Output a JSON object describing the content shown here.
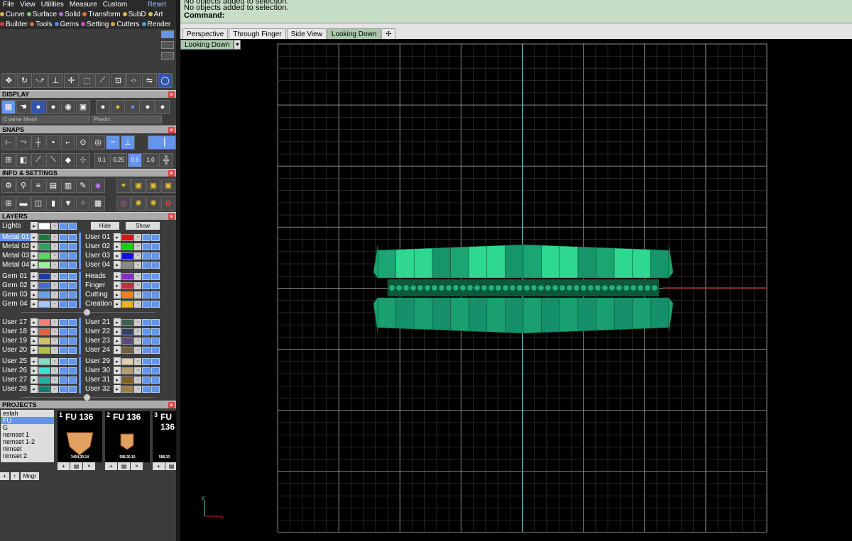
{
  "menubar": {
    "items": [
      "File",
      "View",
      "Utilities",
      "Measure",
      "Custom"
    ],
    "reset": "Reset"
  },
  "tabs_row1": [
    {
      "label": "Curve",
      "color": "#d4b44c"
    },
    {
      "label": "Surface",
      "color": "#7ec47e"
    },
    {
      "label": "Solid",
      "color": "#b06cd4"
    },
    {
      "label": "Transform",
      "color": "#e07040"
    },
    {
      "label": "SubD",
      "color": "#e0b040"
    },
    {
      "label": "Art",
      "color": "#d4c44c"
    }
  ],
  "tabs_row2": [
    {
      "label": "Builder",
      "color": "#d04040"
    },
    {
      "label": "Tools",
      "color": "#d07040"
    },
    {
      "label": "Gems",
      "color": "#4c8cd4"
    },
    {
      "label": "Setting",
      "color": "#c44cc4"
    },
    {
      "label": "Cutters",
      "color": "#d4a44c"
    },
    {
      "label": "Render",
      "color": "#4ca4d4"
    }
  ],
  "display": {
    "title": "DISPLAY",
    "mesh": "Coarse Mesh",
    "material": "Plastic"
  },
  "snaps": {
    "title": "SNAPS",
    "values": [
      "0.1",
      "0.25",
      "0.5",
      "1.0"
    ]
  },
  "info": {
    "title": "INFO & SETTINGS"
  },
  "layers": {
    "title": "LAYERS",
    "lights": "Lights",
    "hide": "Hide",
    "show": "Show",
    "groups": [
      [
        {
          "left": {
            "name": "Metal 01",
            "color": "#1a7a3e",
            "selected": true
          },
          "right": {
            "name": "User 01",
            "color": "#e01010"
          }
        },
        {
          "left": {
            "name": "Metal 02",
            "color": "#2ea05a"
          },
          "right": {
            "name": "User 02",
            "color": "#10d010"
          }
        },
        {
          "left": {
            "name": "Metal 03",
            "color": "#5cd85c"
          },
          "right": {
            "name": "User 03",
            "color": "#1010e0"
          }
        },
        {
          "left": {
            "name": "Metal 04",
            "color": "#9cf09c"
          },
          "right": {
            "name": "User 04",
            "color": "#888888"
          }
        }
      ],
      [
        {
          "left": {
            "name": "Gem 01",
            "color": "#1a3aa0"
          },
          "right": {
            "name": "Heads",
            "color": "#8a2ac0"
          }
        },
        {
          "left": {
            "name": "Gem 02",
            "color": "#3a70d0"
          },
          "right": {
            "name": "Finger",
            "color": "#c03040"
          }
        },
        {
          "left": {
            "name": "Gem 03",
            "color": "#6ca0e8"
          },
          "right": {
            "name": "Cutting",
            "color": "#f08020"
          }
        },
        {
          "left": {
            "name": "Gem 04",
            "color": "#a0c8f8"
          },
          "right": {
            "name": "Creation",
            "color": "#f0b020"
          }
        }
      ],
      [
        {
          "left": {
            "name": "User 17",
            "color": "#f08080"
          },
          "right": {
            "name": "User 21",
            "color": "#406050"
          }
        },
        {
          "left": {
            "name": "User 18",
            "color": "#e06040"
          },
          "right": {
            "name": "User 22",
            "color": "#304070"
          }
        },
        {
          "left": {
            "name": "User 19",
            "color": "#d0c060"
          },
          "right": {
            "name": "User 23",
            "color": "#5a4a80"
          }
        },
        {
          "left": {
            "name": "User 20",
            "color": "#b0c040"
          },
          "right": {
            "name": "User 24",
            "color": "#706040"
          }
        }
      ],
      [
        {
          "left": {
            "name": "User 25",
            "color": "#80e0c0"
          },
          "right": {
            "name": "User 29",
            "color": "#e0d0b0"
          }
        },
        {
          "left": {
            "name": "User 26",
            "color": "#40e0d0"
          },
          "right": {
            "name": "User 30",
            "color": "#b0a070"
          }
        },
        {
          "left": {
            "name": "User 27",
            "color": "#20b0a0"
          },
          "right": {
            "name": "User 31",
            "color": "#806020"
          }
        },
        {
          "left": {
            "name": "User 28",
            "color": "#108070"
          },
          "right": {
            "name": "User 32",
            "color": "#a08040"
          }
        }
      ]
    ]
  },
  "projects": {
    "title": "PROJECTS",
    "list": [
      "eslah",
      "FU",
      "G",
      "nemset 1",
      "nemset 1-2",
      "nimset",
      "nimset 2"
    ],
    "selected": "FU",
    "thumbs": [
      {
        "num": "1",
        "label": "FU 136",
        "caption": "3404,30,14"
      },
      {
        "num": "2",
        "label": "FU 136",
        "caption": "588,30,10"
      },
      {
        "num": "3",
        "label": "FU 136",
        "caption": "588,30"
      }
    ],
    "mngr": "Mngr"
  },
  "command": {
    "line1": "No objects added to selection.",
    "line2": "No objects added to selection.",
    "prompt": "Command:"
  },
  "viewtabs": [
    {
      "label": "Perspective",
      "active": false
    },
    {
      "label": "Through Finger",
      "active": false
    },
    {
      "label": "Side View",
      "active": false
    },
    {
      "label": "Looking Down",
      "active": true
    }
  ],
  "viewport": {
    "label": "Looking Down",
    "axis_y": "y",
    "axis_x": "x",
    "object_color": "#1aa86c"
  }
}
